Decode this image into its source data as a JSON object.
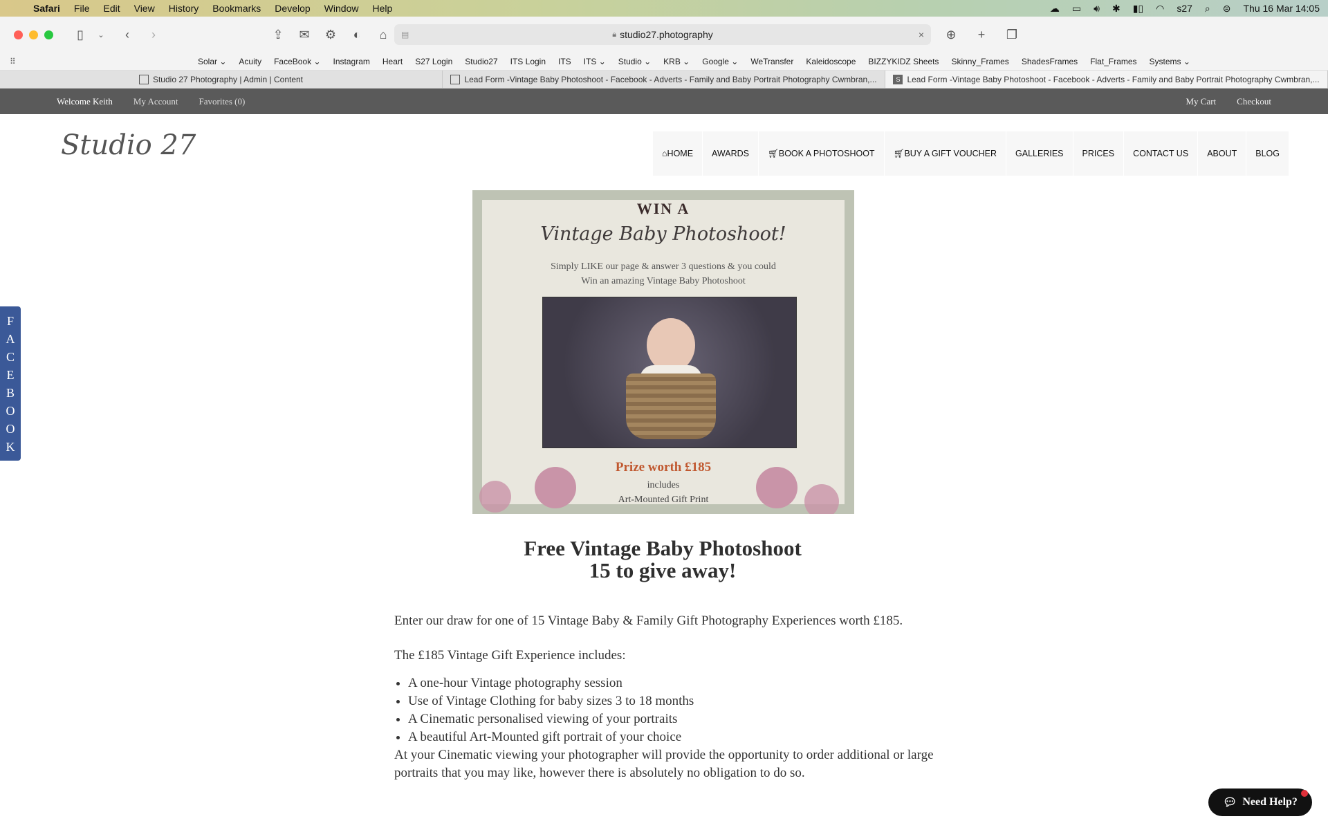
{
  "menubar": {
    "app": "Safari",
    "items": [
      "File",
      "Edit",
      "View",
      "History",
      "Bookmarks",
      "Develop",
      "Window",
      "Help"
    ],
    "user": "s27",
    "datetime": "Thu 16 Mar  14:05"
  },
  "toolbar": {
    "url": "studio27.photography"
  },
  "bookmarks": [
    "Solar ⌄",
    "Acuity",
    "FaceBook ⌄",
    "Instagram",
    "Heart",
    "S27 Login",
    "Studio27",
    "ITS Login",
    "ITS",
    "ITS ⌄",
    "Studio ⌄",
    "KRB ⌄",
    "Google ⌄",
    "WeTransfer",
    "Kaleidoscope",
    "BIZZYKIDZ Sheets",
    "Skinny_Frames",
    "ShadesFrames",
    "Flat_Frames",
    "Systems ⌄"
  ],
  "tabs": [
    {
      "label": "Studio 27 Photography | Admin | Content"
    },
    {
      "label": "Lead Form -Vintage Baby Photoshoot - Facebook - Adverts - Family and Baby Portrait Photography Cwmbran,..."
    },
    {
      "label": "Lead Form -Vintage Baby Photoshoot - Facebook - Adverts - Family and Baby Portrait Photography Cwmbran,..."
    }
  ],
  "sitebar": {
    "welcome": "Welcome Keith",
    "my_account": "My Account",
    "favorites": "Favorites (0)",
    "my_cart": "My Cart",
    "checkout": "Checkout"
  },
  "logo": "Studio 27",
  "nav": [
    "HOME",
    "AWARDS",
    "BOOK A PHOTOSHOOT",
    "BUY A GIFT VOUCHER",
    "GALLERIES",
    "PRICES",
    "CONTACT US",
    "ABOUT",
    "BLOG"
  ],
  "promo": {
    "win": "WIN A",
    "script": "Vintage Baby Photoshoot!",
    "sub1": "Simply LIKE our page & answer 3 questions & you could",
    "sub2": "Win an amazing Vintage Baby Photoshoot",
    "prize": "Prize worth £185",
    "includes1": "includes",
    "includes2": "Art-Mounted Gift Print"
  },
  "article": {
    "title1": "Free Vintage Baby Photoshoot",
    "title2": "15 to give away!",
    "p1": "Enter our draw for one of 15 Vintage Baby & Family Gift Photography Experiences worth £185.",
    "p2": "The £185 Vintage Gift Experience includes:",
    "list": [
      "A one-hour Vintage photography session",
      "Use of Vintage Clothing for baby sizes 3 to 18 months",
      "A Cinematic personalised viewing of your portraits",
      "A beautiful Art-Mounted gift portrait of your choice"
    ],
    "p3": "At your Cinematic viewing your photographer will provide the opportunity to order additional or large portraits that you may like, however there is absolutely no obligation to do so."
  },
  "fbtab": [
    "F",
    "A",
    "C",
    "E",
    "B",
    "O",
    "O",
    "K"
  ],
  "help": "Need Help?"
}
